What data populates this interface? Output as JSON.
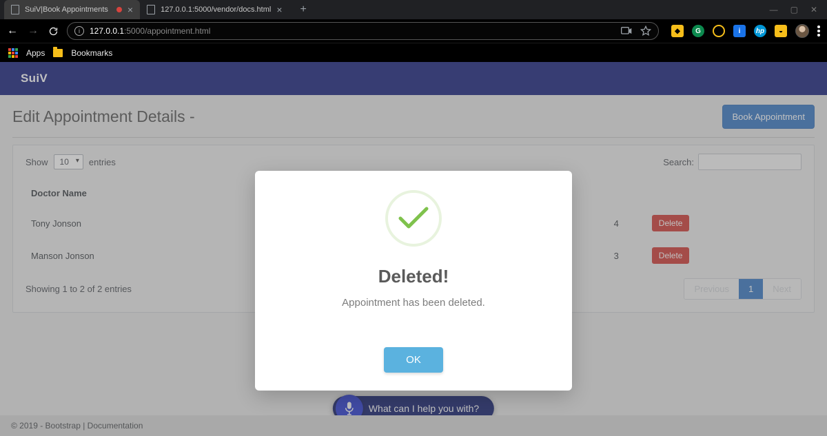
{
  "browser": {
    "tabs": [
      {
        "title": "SuiV|Book Appointments",
        "active": true,
        "recording": true
      },
      {
        "title": "127.0.0.1:5000/vendor/docs.html",
        "active": false,
        "recording": false
      }
    ],
    "url_plain": "127.0.0.1",
    "url_grey": ":5000/appointment.html",
    "apps_label": "Apps",
    "bookmarks_label": "Bookmarks"
  },
  "nav": {
    "brand": "SuiV"
  },
  "page": {
    "title": "Edit Appointment Details -",
    "book_btn": "Book Appointment"
  },
  "datatable": {
    "show_label": "Show",
    "entries_label": "entries",
    "page_size": "10",
    "search_label": "Search:",
    "search_value": "",
    "columns": {
      "name": "Doctor Name"
    },
    "rows": [
      {
        "name": "Tony Jonson",
        "num": "4",
        "action": "Delete"
      },
      {
        "name": "Manson Jonson",
        "num": "3",
        "action": "Delete"
      }
    ],
    "info": "Showing 1 to 2 of 2 entries",
    "pager": {
      "prev": "Previous",
      "current": "1",
      "next": "Next"
    }
  },
  "voice": {
    "prompt": "What can I help you with?"
  },
  "footer": {
    "text": "© 2019 - Bootstrap | Documentation"
  },
  "modal": {
    "title": "Deleted!",
    "message": "Appointment has been deleted.",
    "ok": "OK"
  },
  "colors": {
    "navbar": "#1a237e",
    "primary_btn": "#3a79c4",
    "danger_btn": "#cf3d37",
    "modal_ok": "#5bb2df",
    "check_green": "#7fc24c"
  }
}
